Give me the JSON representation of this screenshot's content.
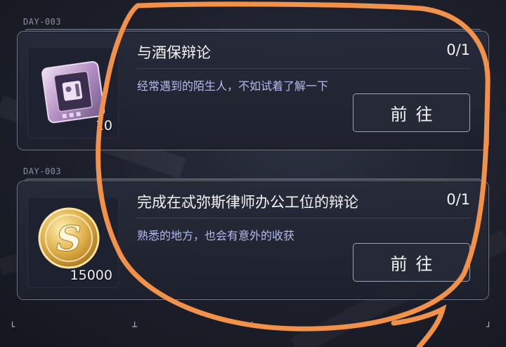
{
  "tasks": [
    {
      "day_tag": "DAY-003",
      "title": "与酒保辩论",
      "progress": "0/1",
      "description": "经常遇到的陌生人，不如试着了解一下",
      "reward_icon": "chip-card-icon",
      "reward_qty": "10",
      "button_label": "前往"
    },
    {
      "day_tag": "DAY-003",
      "title": "完成在忒弥斯律师办公工位的辩论",
      "progress": "0/1",
      "description": "熟悉的地方，也会有意外的收获",
      "reward_icon": "gold-coin-icon",
      "reward_qty": "15000",
      "button_label": "前往"
    }
  ],
  "colors": {
    "annotation_stroke": "#f2914a",
    "description_text": "#b5b9ec",
    "coin_gold": "#e0b04a"
  }
}
